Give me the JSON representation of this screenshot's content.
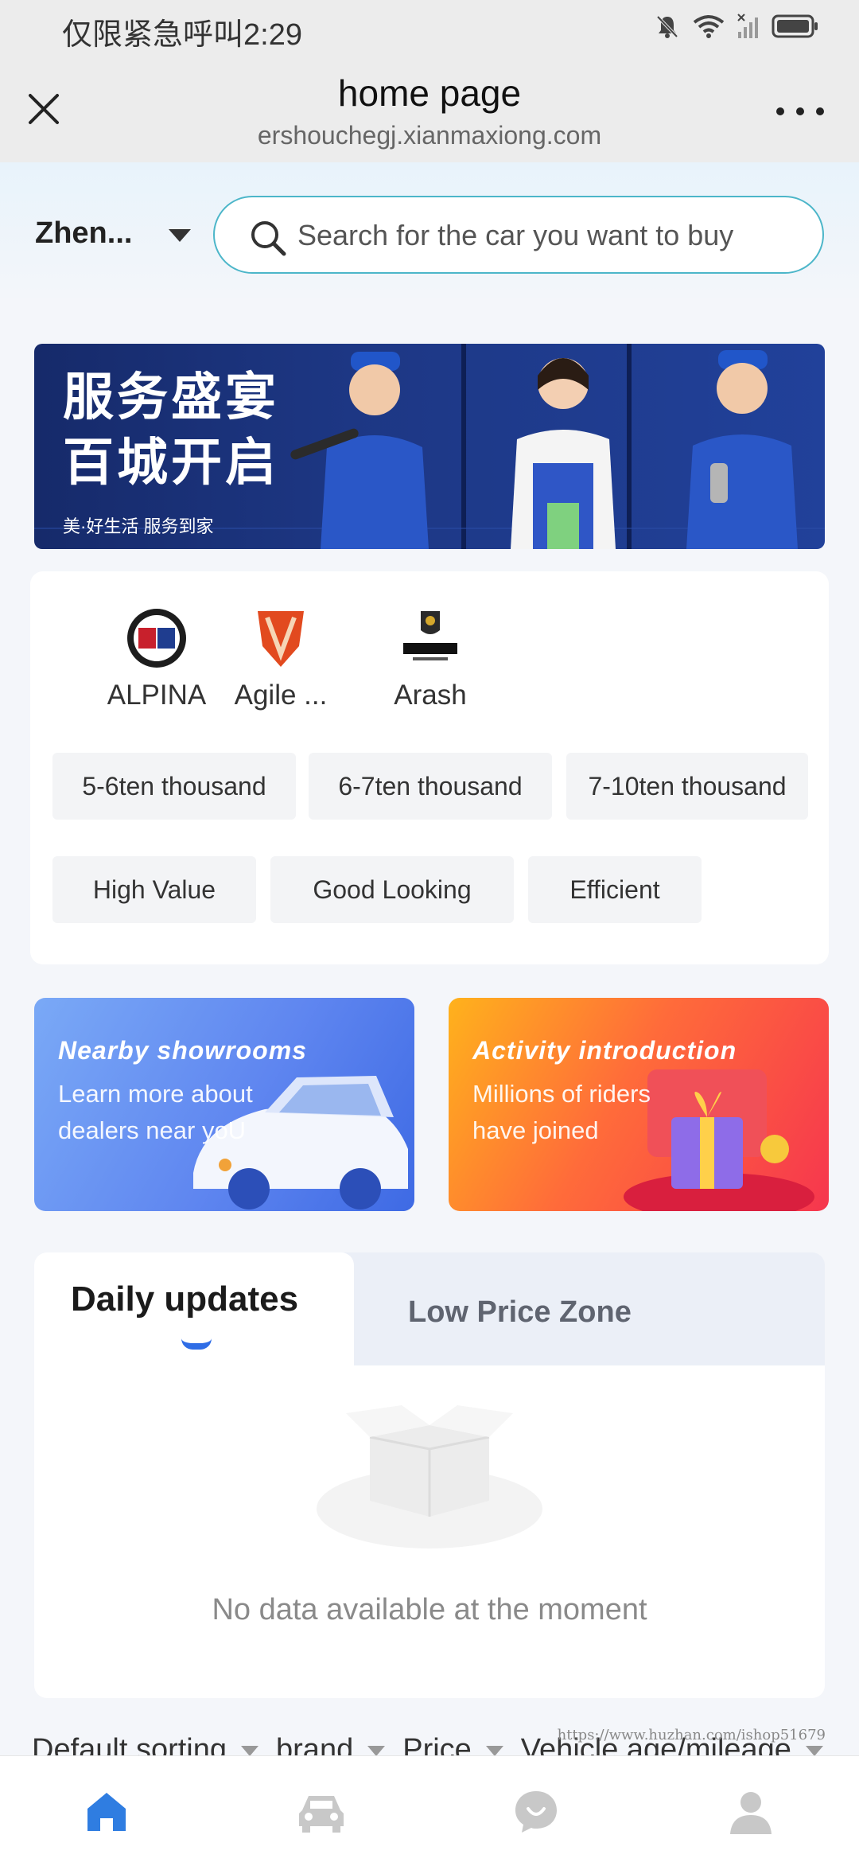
{
  "status_bar": {
    "carrier_text": "仅限紧急呼叫",
    "time": "2:29",
    "icons": [
      "mute-bell-icon",
      "wifi-icon",
      "no-signal-icon",
      "battery-icon"
    ]
  },
  "title_bar": {
    "title": "home page",
    "url": "ershouchegj.xianmaxiong.com",
    "close_icon": "close-icon",
    "more_icon": "more-icon"
  },
  "search": {
    "city": "Zhen...",
    "placeholder": "Search for the car you want to buy",
    "accent_color": "#4cb6c9"
  },
  "banner": {
    "line1": "服务盛宴",
    "line2": "百城开启",
    "tagline": "美·好生活 服务到家"
  },
  "brands": [
    {
      "name": "ALPINA"
    },
    {
      "name": "Agile ..."
    },
    {
      "name": "Arash"
    }
  ],
  "price_filters": [
    "5-6ten thousand",
    "6-7ten thousand",
    "7-10ten thousand"
  ],
  "feature_filters": [
    "High Value",
    "Good Looking",
    "Efficient"
  ],
  "promos": [
    {
      "title": "Nearby showrooms",
      "description": "Learn more about dealers near yoU"
    },
    {
      "title": "Activity introduction",
      "description": "Millions of riders have joined"
    }
  ],
  "tabs": {
    "daily": "Daily updates",
    "low_price": "Low Price Zone",
    "indicator_color": "#2f6de6"
  },
  "empty_state": {
    "message": "No data available at the moment"
  },
  "sort_bar": {
    "default": "Default sorting",
    "brand": "brand",
    "price": "Price",
    "age": "Vehicle age/mileage"
  },
  "watermark": "https://www.huzhan.com/ishop51679",
  "bottom_nav": [
    {
      "icon": "home-icon",
      "active": true,
      "color": "#2f7de1"
    },
    {
      "icon": "car-icon",
      "active": false,
      "color": "#c8c8c8"
    },
    {
      "icon": "chat-icon",
      "active": false,
      "color": "#c8c8c8"
    },
    {
      "icon": "user-icon",
      "active": false,
      "color": "#c8c8c8"
    }
  ]
}
